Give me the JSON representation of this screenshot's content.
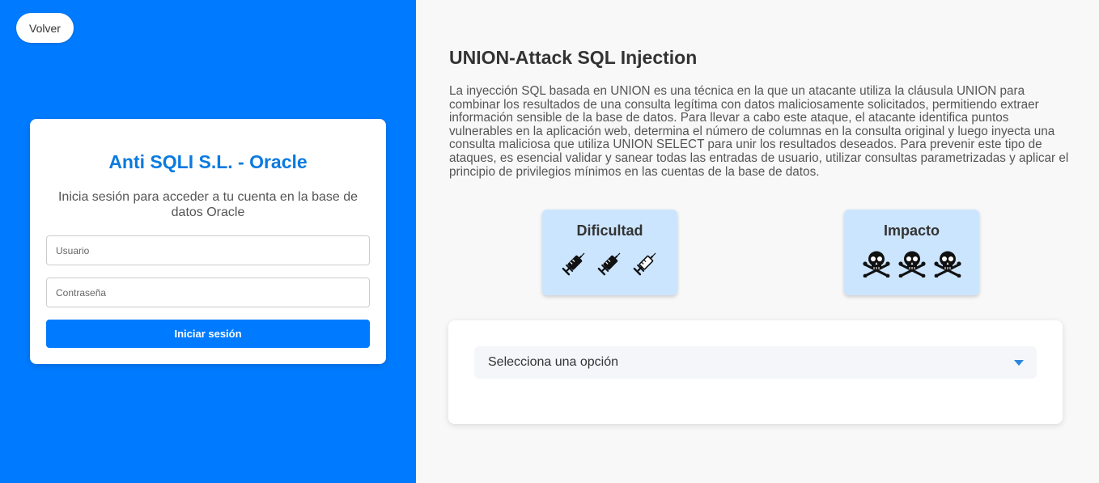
{
  "back_button": {
    "label": "Volver"
  },
  "login": {
    "title": "Anti SQLI S.L. - Oracle",
    "subtitle": "Inicia sesión para acceder a tu cuenta en la base de datos Oracle",
    "username_placeholder": "Usuario",
    "password_placeholder": "Contraseña",
    "submit_label": "Iniciar sesión"
  },
  "article": {
    "title": "UNION-Attack SQL Injection",
    "description": "La inyección SQL basada en UNION es una técnica en la que un atacante utiliza la cláusula UNION para combinar los resultados de una consulta legítima con datos maliciosamente solicitados, permitiendo extraer información sensible de la base de datos. Para llevar a cabo este ataque, el atacante identifica puntos vulnerables en la aplicación web, determina el número de columnas en la consulta original y luego inyecta una consulta maliciosa que utiliza UNION SELECT para unir los resultados deseados. Para prevenir este tipo de ataques, es esencial validar y sanear todas las entradas de usuario, utilizar consultas parametrizadas y aplicar el principio de privilegios mínimos en las cuentas de la base de datos."
  },
  "metrics": {
    "difficulty": {
      "title": "Dificultad",
      "icon": "syringe-icon",
      "level": 2,
      "max": 3
    },
    "impact": {
      "title": "Impacto",
      "icon": "skull-crossbones-icon",
      "level": 3,
      "max": 3
    }
  },
  "select": {
    "selected": "Selecciona una opción"
  },
  "colors": {
    "brand": "#007bff",
    "title_blue": "#0a7ae0",
    "metric_bg": "#cce5ff",
    "arrow": "#2b87d8"
  }
}
